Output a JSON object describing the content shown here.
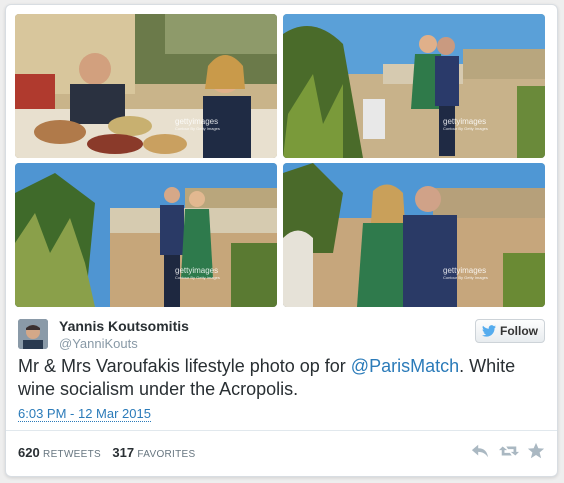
{
  "photos": [
    {
      "label": "photo-dinner-table",
      "watermark": "gettyimages",
      "watermark_sub": "Contour By Getty Images"
    },
    {
      "label": "photo-terrace-embrace",
      "watermark": "gettyimages",
      "watermark_sub": "Contour By Getty Images"
    },
    {
      "label": "photo-couple-standing-garden",
      "watermark": "gettyimages",
      "watermark_sub": "Contour By Getty Images"
    },
    {
      "label": "photo-couple-close-acropolis",
      "watermark": "gettyimages",
      "watermark_sub": "Contour By Getty Images"
    }
  ],
  "author": {
    "name": "Yannis Koutsomitis",
    "handle": "@YanniKouts"
  },
  "follow_label": "Follow",
  "tweet": {
    "text_before": "Mr & Mrs Varoufakis lifestyle photo op for ",
    "mention": "@ParisMatch",
    "text_after": ". White wine socialism under the Acropolis.",
    "timestamp": "6:03 PM - 12 Mar 2015"
  },
  "stats": {
    "retweets_count": "620",
    "retweets_label": "RETWEETS",
    "favorites_count": "317",
    "favorites_label": "FAVORITES"
  },
  "icons": [
    "reply-icon",
    "retweet-icon",
    "favorite-star-icon",
    "twitter-bird-icon"
  ],
  "colors": {
    "link": "#2b7bb9",
    "muted": "#8899a6",
    "text": "#292f33",
    "action_icon": "#aab8c2"
  }
}
